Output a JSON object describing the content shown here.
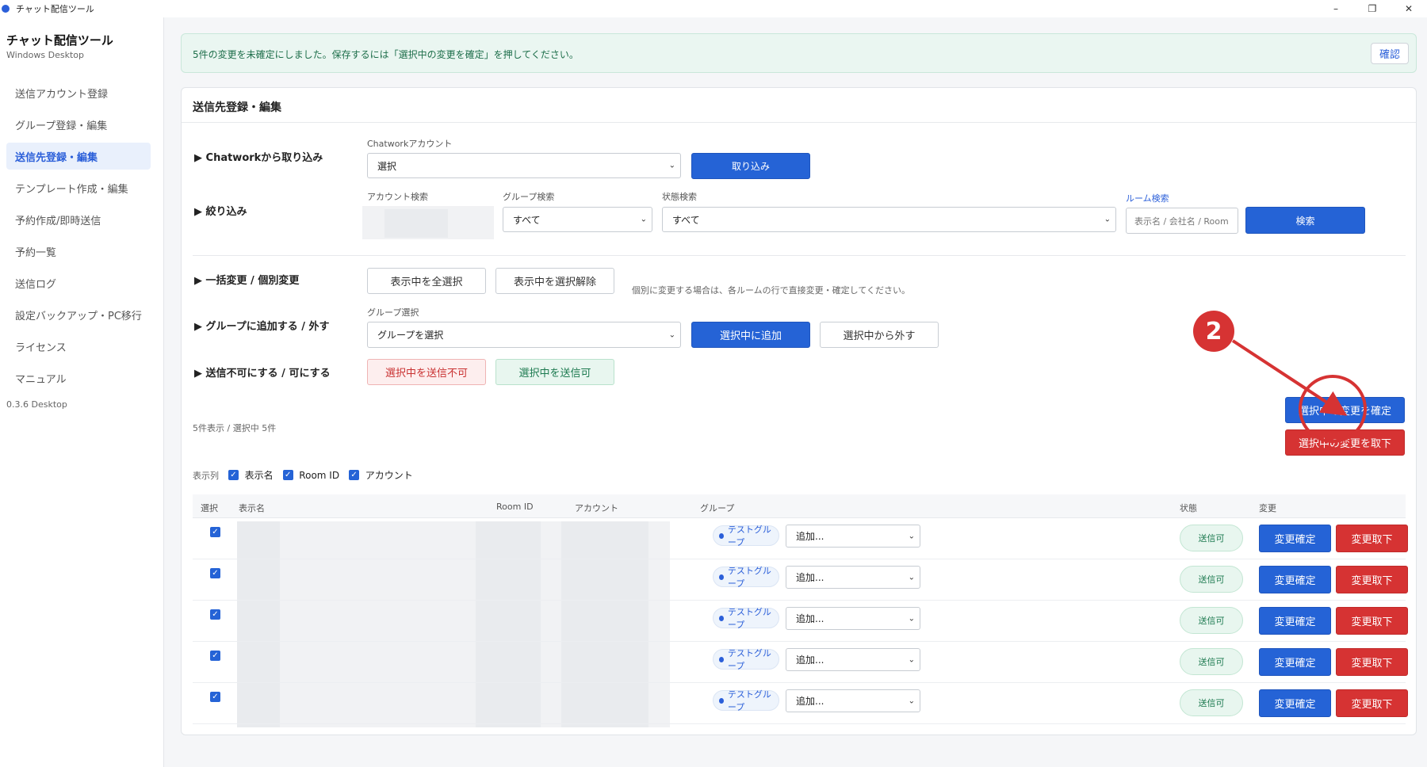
{
  "window": {
    "title": "チャット配信ツール",
    "controls": {
      "minimize": "–",
      "maximize": "❐",
      "close": "✕"
    }
  },
  "sidebar": {
    "app_title": "チャット配信ツール",
    "app_subtitle": "Windows Desktop",
    "items": [
      {
        "label": "送信アカウント登録",
        "active": false
      },
      {
        "label": "グループ登録・編集",
        "active": false
      },
      {
        "label": "送信先登録・編集",
        "active": true
      },
      {
        "label": "テンプレート作成・編集",
        "active": false
      },
      {
        "label": "予約作成/即時送信",
        "active": false
      },
      {
        "label": "予約一覧",
        "active": false
      },
      {
        "label": "送信ログ",
        "active": false
      },
      {
        "label": "設定バックアップ・PC移行",
        "active": false
      },
      {
        "label": "ライセンス",
        "active": false
      },
      {
        "label": "マニュアル",
        "active": false
      }
    ],
    "version": "0.3.6 Desktop"
  },
  "notice": {
    "message": "5件の変更を未確定にしました。保存するには「選択中の変更を確定」を押してください。",
    "ok_label": "確認"
  },
  "main": {
    "title": "送信先登録・編集",
    "import": {
      "section_label": "▶ Chatworkから取り込み",
      "account_label": "Chatworkアカウント",
      "account_value": "選択",
      "import_button": "取り込み"
    },
    "filter": {
      "section_label": "▶ 絞り込み",
      "account_search_label": "アカウント検索",
      "group_search_label": "グループ検索",
      "group_search_value": "すべて",
      "state_search_label": "状態検索",
      "state_search_value": "すべて",
      "room_search_label": "ルーム検索",
      "room_search_placeholder": "表示名 / 会社名 / Room",
      "search_button": "検索"
    },
    "bulk": {
      "section_label": "▶ 一括変更 / 個別変更",
      "select_all_button": "表示中を全選択",
      "deselect_button": "表示中を選択解除",
      "hint": "個別に変更する場合は、各ルームの行で直接変更・確定してください。"
    },
    "group_assign": {
      "section_label": "▶ グループに追加する / 外す",
      "group_select_label": "グループ選択",
      "group_select_value": "グループを選択",
      "add_button": "選択中に追加",
      "remove_button": "選択中から外す"
    },
    "sendable": {
      "section_label": "▶ 送信不可にする / 可にする",
      "disable_button": "選択中を送信不可",
      "enable_button": "選択中を送信可"
    },
    "confirm_selected_button": "選択中の変更を確定",
    "discard_selected_button": "選択中の変更を取下",
    "count_text": "5件表示 / 選択中 5件",
    "columns": {
      "label": "表示列",
      "options": [
        {
          "label": "表示名",
          "checked": true
        },
        {
          "label": "Room ID",
          "checked": true
        },
        {
          "label": "アカウント",
          "checked": true
        }
      ]
    },
    "table": {
      "headers": {
        "select": "選択",
        "display_name": "表示名",
        "room_id": "Room ID",
        "account": "アカウント",
        "group": "グループ",
        "state": "状態",
        "change": "変更"
      },
      "rows": [
        {
          "checked": true,
          "group_badge": "テストグループ",
          "add_select": "追加...",
          "state": "送信可",
          "confirm": "変更確定",
          "discard": "変更取下"
        },
        {
          "checked": true,
          "group_badge": "テストグループ",
          "add_select": "追加...",
          "state": "送信可",
          "confirm": "変更確定",
          "discard": "変更取下"
        },
        {
          "checked": true,
          "group_badge": "テストグループ",
          "add_select": "追加...",
          "state": "送信可",
          "confirm": "変更確定",
          "discard": "変更取下"
        },
        {
          "checked": true,
          "group_badge": "テストグループ",
          "add_select": "追加...",
          "state": "送信可",
          "confirm": "変更確定",
          "discard": "変更取下"
        },
        {
          "checked": true,
          "group_badge": "テストグループ",
          "add_select": "追加...",
          "state": "送信可",
          "confirm": "変更確定",
          "discard": "変更取下"
        }
      ]
    }
  },
  "annotation": {
    "step_number": "2"
  },
  "colors": {
    "accent": "#2563d6",
    "danger": "#d63333",
    "success": "#1d7a50"
  }
}
